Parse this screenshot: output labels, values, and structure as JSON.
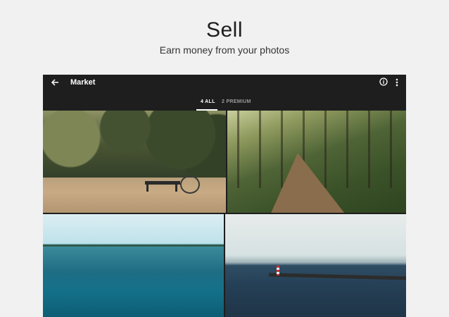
{
  "promo": {
    "headline": "Sell",
    "subheadline": "Earn money from your photos"
  },
  "appbar": {
    "title": "Market",
    "icons": [
      "arrow-back-icon",
      "info-icon",
      "more-vert-icon"
    ]
  },
  "tabs": [
    {
      "label": "4 ALL",
      "active": true
    },
    {
      "label": "2 PREMIUM",
      "active": false
    }
  ],
  "photos": [
    {
      "subject": "bench-and-bicycle-in-forest-clearing"
    },
    {
      "subject": "forest-dirt-path"
    },
    {
      "subject": "turquoise-sea-horizon"
    },
    {
      "subject": "pier-with-lighthouse"
    }
  ],
  "colors": {
    "background": "#f1f1f1",
    "appbar": "#1e1e1e",
    "tab_active": "#ffffff",
    "tab_inactive": "#9a9a9a"
  }
}
